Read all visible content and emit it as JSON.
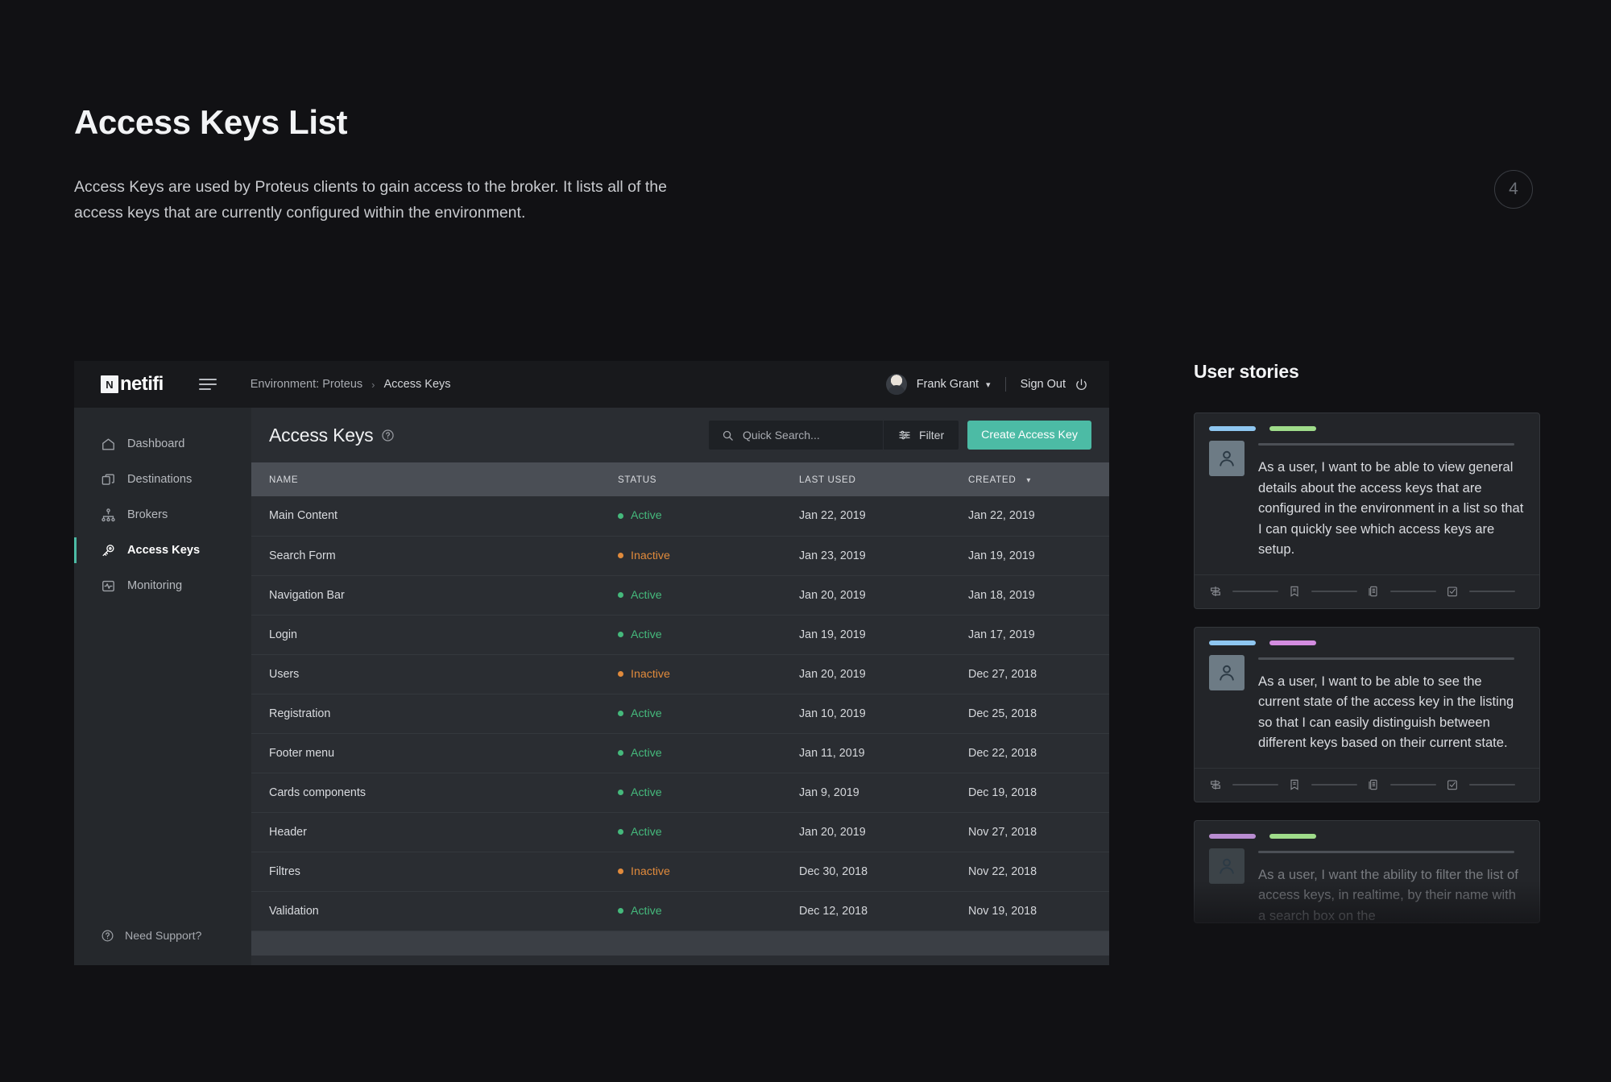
{
  "intro": {
    "title": "Access Keys List",
    "description": "Access Keys are used by Proteus clients to gain access to the broker. It lists all of the access keys that are currently configured within the environment.",
    "page_number": "4"
  },
  "app": {
    "logo": {
      "mark": "N",
      "text": "netifi"
    },
    "breadcrumb": {
      "environment": "Environment: Proteus",
      "separator": "›",
      "current": "Access Keys"
    },
    "user": {
      "name": "Frank Grant",
      "sign_out": "Sign Out"
    },
    "sidebar": {
      "items": [
        {
          "label": "Dashboard",
          "icon": "home-icon",
          "active": false
        },
        {
          "label": "Destinations",
          "icon": "layers-icon",
          "active": false
        },
        {
          "label": "Brokers",
          "icon": "hierarchy-icon",
          "active": false
        },
        {
          "label": "Access Keys",
          "icon": "key-icon",
          "active": true
        },
        {
          "label": "Monitoring",
          "icon": "activity-icon",
          "active": false
        }
      ],
      "support": "Need Support?"
    },
    "content": {
      "title": "Access Keys",
      "search_placeholder": "Quick Search...",
      "search_value": "",
      "filter_label": "Filter",
      "create_label": "Create Access Key",
      "columns": [
        "NAME",
        "STATUS",
        "LAST USED",
        "CREATED"
      ],
      "sort_column": "CREATED",
      "rows": [
        {
          "name": "Main Content",
          "status": "Active",
          "last_used": "Jan 22, 2019",
          "created": "Jan 22, 2019"
        },
        {
          "name": "Search Form",
          "status": "Inactive",
          "last_used": "Jan 23, 2019",
          "created": "Jan 19, 2019"
        },
        {
          "name": "Navigation Bar",
          "status": "Active",
          "last_used": "Jan 20, 2019",
          "created": "Jan 18, 2019"
        },
        {
          "name": "Login",
          "status": "Active",
          "last_used": "Jan 19, 2019",
          "created": "Jan 17, 2019"
        },
        {
          "name": "Users",
          "status": "Inactive",
          "last_used": "Jan 20, 2019",
          "created": "Dec 27, 2018"
        },
        {
          "name": "Registration",
          "status": "Active",
          "last_used": "Jan 10, 2019",
          "created": "Dec 25, 2018"
        },
        {
          "name": "Footer menu",
          "status": "Active",
          "last_used": "Jan 11, 2019",
          "created": "Dec 22, 2018"
        },
        {
          "name": "Cards components",
          "status": "Active",
          "last_used": "Jan 9, 2019",
          "created": "Dec 19, 2018"
        },
        {
          "name": "Header",
          "status": "Active",
          "last_used": "Jan 20, 2019",
          "created": "Nov 27, 2018"
        },
        {
          "name": "Filtres",
          "status": "Inactive",
          "last_used": "Dec 30, 2018",
          "created": "Nov 22, 2018"
        },
        {
          "name": "Validation",
          "status": "Active",
          "last_used": "Dec 12, 2018",
          "created": "Nov 19, 2018"
        }
      ]
    }
  },
  "stories": {
    "title": "User stories",
    "cards": [
      {
        "tags": [
          "#8ec6f0",
          "#9fdc8a"
        ],
        "text": "As a user, I want to be able to view general details about the access keys that are configured in the environment in a list so that I can quickly see which access keys are setup.",
        "footer_icons": [
          "signpost-icon",
          "bookmark-icon",
          "documents-icon",
          "checkbox-checked-icon"
        ]
      },
      {
        "tags": [
          "#8ec6f0",
          "#d38ce0"
        ],
        "text": "As a user, I want to be able to see the current state of the access key in the listing so that I can easily distinguish between different keys based on their current state.",
        "footer_icons": [
          "signpost-icon",
          "bookmark-icon",
          "documents-icon",
          "checkbox-checked-icon"
        ]
      },
      {
        "tags": [
          "#b98cd1",
          "#9fdc8a"
        ],
        "text": "As a user, I want the ability to filter the list of access keys, in realtime, by their name with a search box on the",
        "footer_icons": [
          "signpost-icon",
          "bookmark-icon",
          "documents-icon",
          "checkbox-checked-icon"
        ]
      }
    ]
  },
  "colors": {
    "accent_teal": "#4cbba5",
    "status_active": "#45b97c",
    "status_inactive": "#e08a3c",
    "page_background": "#111114"
  }
}
